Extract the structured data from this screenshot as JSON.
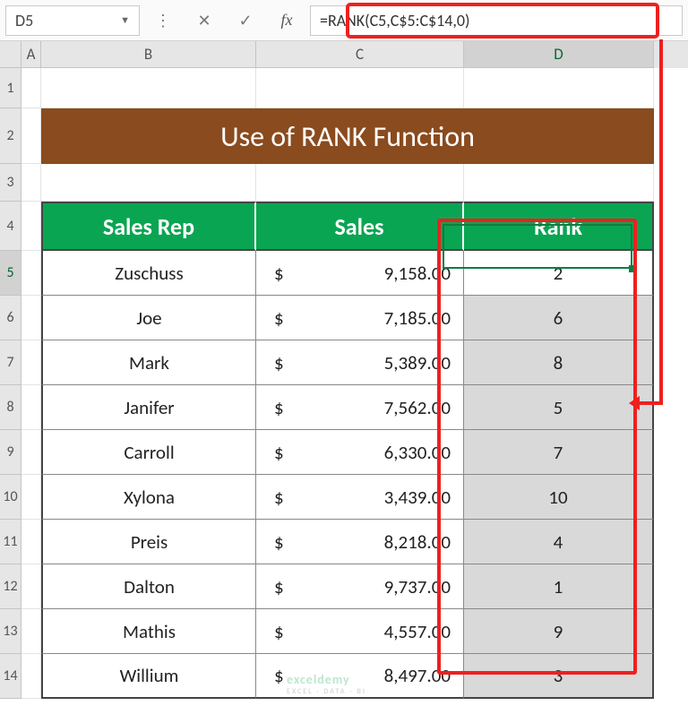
{
  "formula_bar": {
    "namebox": "D5",
    "formula": "=RANK(C5,C$5:C$14,0)",
    "fx_label": "fx"
  },
  "columns": {
    "A": "A",
    "B": "B",
    "C": "C",
    "D": "D"
  },
  "row_numbers": [
    "1",
    "2",
    "3",
    "4",
    "5",
    "6",
    "7",
    "8",
    "9",
    "10",
    "11",
    "12",
    "13",
    "14"
  ],
  "title": "Use of RANK Function",
  "headers": {
    "rep": "Sales Rep",
    "sales": "Sales",
    "rank": "Rank"
  },
  "currency": "$",
  "rows": [
    {
      "rep": "Zuschuss",
      "sales": "9,158.00",
      "rank": "2"
    },
    {
      "rep": "Joe",
      "sales": "7,185.00",
      "rank": "6"
    },
    {
      "rep": "Mark",
      "sales": "5,389.00",
      "rank": "8"
    },
    {
      "rep": "Janifer",
      "sales": "7,562.00",
      "rank": "5"
    },
    {
      "rep": "Carroll",
      "sales": "6,330.00",
      "rank": "7"
    },
    {
      "rep": "Xylona",
      "sales": "3,439.00",
      "rank": "10"
    },
    {
      "rep": "Preis",
      "sales": "8,218.00",
      "rank": "4"
    },
    {
      "rep": "Dalton",
      "sales": "9,737.00",
      "rank": "1"
    },
    {
      "rep": "Mathis",
      "sales": "4,557.00",
      "rank": "9"
    },
    {
      "rep": "Willium",
      "sales": "8,497.00",
      "rank": "3"
    }
  ],
  "watermark": {
    "main": "exceldemy",
    "sub": "EXCEL · DATA · BI"
  },
  "chart_data": {
    "type": "table",
    "title": "Use of RANK Function",
    "columns": [
      "Sales Rep",
      "Sales",
      "Rank"
    ],
    "rows": [
      [
        "Zuschuss",
        9158.0,
        2
      ],
      [
        "Joe",
        7185.0,
        6
      ],
      [
        "Mark",
        5389.0,
        8
      ],
      [
        "Janifer",
        7562.0,
        5
      ],
      [
        "Carroll",
        6330.0,
        7
      ],
      [
        "Xylona",
        3439.0,
        10
      ],
      [
        "Preis",
        8218.0,
        4
      ],
      [
        "Dalton",
        9737.0,
        1
      ],
      [
        "Mathis",
        4557.0,
        9
      ],
      [
        "Willium",
        8497.0,
        3
      ]
    ]
  }
}
